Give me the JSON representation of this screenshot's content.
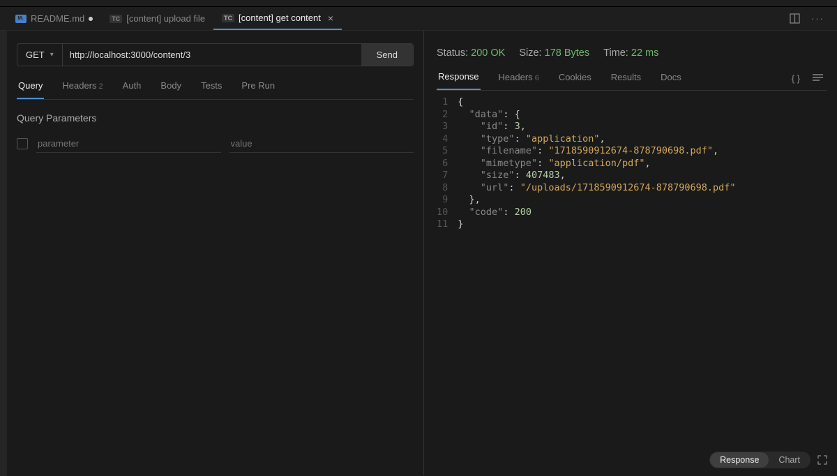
{
  "tabs": [
    {
      "icon": "md",
      "label": "README.md",
      "dirty": true
    },
    {
      "icon": "tc",
      "label": "[content] upload file"
    },
    {
      "icon": "tc",
      "label": "[content] get content",
      "active": true,
      "closeable": true
    }
  ],
  "request": {
    "method": "GET",
    "url": "http://localhost:3000/content/3",
    "send_label": "Send",
    "tabs": [
      {
        "label": "Query",
        "active": true
      },
      {
        "label": "Headers",
        "count": "2"
      },
      {
        "label": "Auth"
      },
      {
        "label": "Body"
      },
      {
        "label": "Tests"
      },
      {
        "label": "Pre Run"
      }
    ],
    "section_title": "Query Parameters",
    "param_placeholder": "parameter",
    "value_placeholder": "value"
  },
  "response": {
    "status_label": "Status:",
    "status_value": "200 OK",
    "size_label": "Size:",
    "size_value": "178 Bytes",
    "time_label": "Time:",
    "time_value": "22 ms",
    "tabs": [
      {
        "label": "Response",
        "active": true
      },
      {
        "label": "Headers",
        "count": "6"
      },
      {
        "label": "Cookies"
      },
      {
        "label": "Results"
      },
      {
        "label": "Docs"
      }
    ],
    "body": {
      "data": {
        "id": 3,
        "type": "application",
        "filename": "1718590912674-878790698.pdf",
        "mimetype": "application/pdf",
        "size": 407483,
        "url": "/uploads/1718590912674-878790698.pdf"
      },
      "code": 200
    },
    "toggle": {
      "response": "Response",
      "chart": "Chart"
    }
  }
}
